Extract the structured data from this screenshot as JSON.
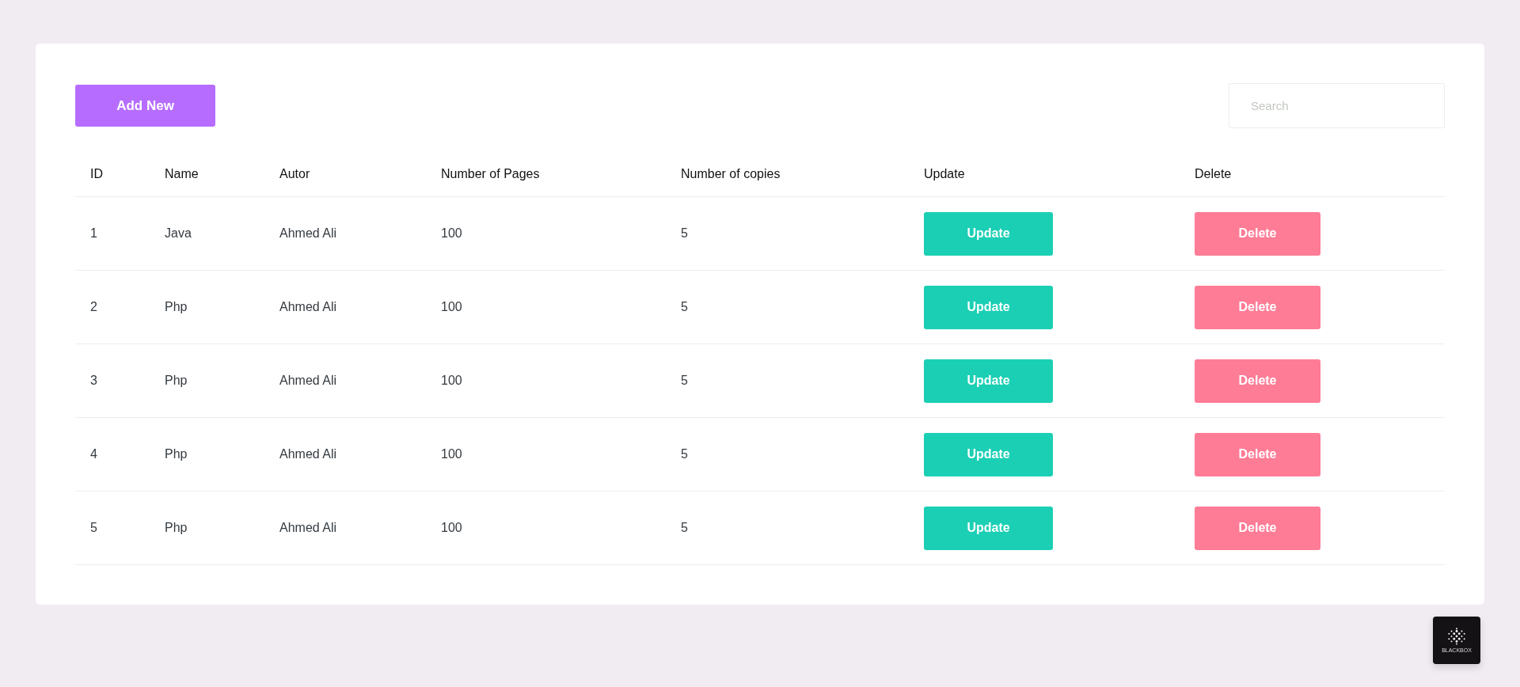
{
  "toolbar": {
    "add_button": "Add New",
    "search": {
      "placeholder": "Search"
    }
  },
  "table": {
    "columns": [
      "ID",
      "Name",
      "Autor",
      "Number of Pages",
      "Number of copies",
      "Update",
      "Delete"
    ],
    "rows": [
      {
        "cells": [
          "1",
          "Java",
          "Ahmed Ali",
          "100",
          "5"
        ],
        "actions": [
          {
            "kind": "update",
            "label": "Update"
          },
          {
            "kind": "delete",
            "label": "Delete"
          }
        ]
      },
      {
        "cells": [
          "2",
          "Php",
          "Ahmed Ali",
          "100",
          "5"
        ],
        "actions": [
          {
            "kind": "update",
            "label": "Update"
          },
          {
            "kind": "delete",
            "label": "Delete"
          }
        ]
      },
      {
        "cells": [
          "3",
          "Php",
          "Ahmed Ali",
          "100",
          "5"
        ],
        "actions": [
          {
            "kind": "update",
            "label": "Update"
          },
          {
            "kind": "delete",
            "label": "Delete"
          }
        ]
      },
      {
        "cells": [
          "4",
          "Php",
          "Ahmed Ali",
          "100",
          "5"
        ],
        "actions": [
          {
            "kind": "update",
            "label": "Update"
          },
          {
            "kind": "delete",
            "label": "Delete"
          }
        ]
      },
      {
        "cells": [
          "5",
          "Php",
          "Ahmed Ali",
          "100",
          "5"
        ],
        "actions": [
          {
            "kind": "update",
            "label": "Update"
          },
          {
            "kind": "delete",
            "label": "Delete"
          }
        ]
      }
    ]
  },
  "extension_widget": {
    "label": "BLACKBOX"
  }
}
